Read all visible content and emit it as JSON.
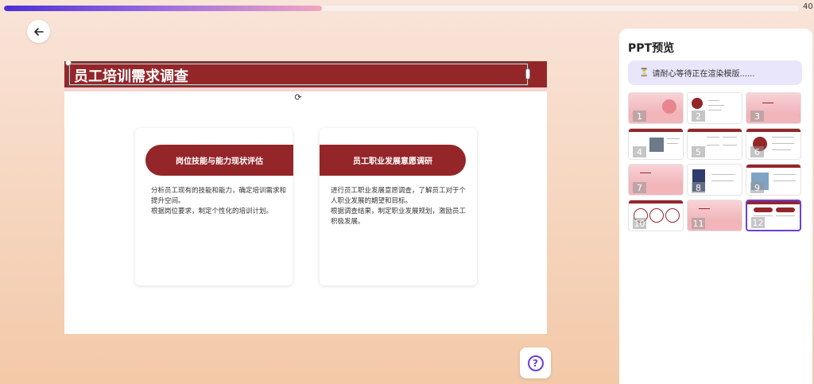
{
  "progress": {
    "label": "40",
    "fraction": 0.4
  },
  "slide": {
    "title": "员工培训需求调查",
    "cards": [
      {
        "heading": "岗位技能与能力现状评估",
        "paragraphs": [
          "分析员工现有的技能和能力，确定培训需求和提升空间。",
          "根据岗位要求，制定个性化的培训计划。"
        ]
      },
      {
        "heading": "员工职业发展意愿调研",
        "paragraphs": [
          "进行员工职业发展意愿调查，了解员工对于个人职业发展的期望和目标。",
          "根据调查结果，制定职业发展规划，激励员工积极发展。"
        ]
      }
    ]
  },
  "panel": {
    "title": "PPT预览",
    "status_icon": "hourglass-icon",
    "status_text": "请耐心等待正在渲染模版......",
    "thumbnails": [
      "1",
      "2",
      "3",
      "4",
      "5",
      "6",
      "7",
      "8",
      "9",
      "10",
      "11",
      "12"
    ],
    "selected": "12"
  },
  "colors": {
    "brand": "#94262a",
    "accent": "#6b3fd8"
  },
  "icons": {
    "back": "arrow-left-icon",
    "help": "question-icon",
    "rotate": "rotate-icon"
  }
}
